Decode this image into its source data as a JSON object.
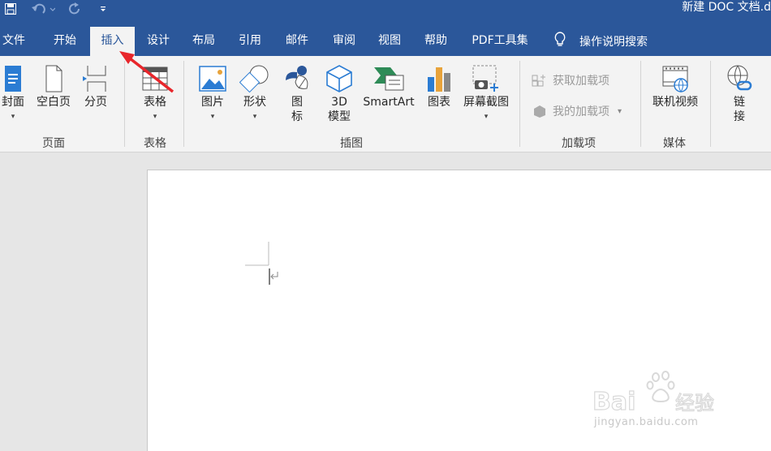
{
  "window": {
    "title": "新建 DOC 文档.d"
  },
  "qat": {
    "icons": [
      "save-icon",
      "undo-icon",
      "redo-icon",
      "customize-qat-icon"
    ]
  },
  "tabs": [
    {
      "label": "文件"
    },
    {
      "label": "开始"
    },
    {
      "label": "插入",
      "active": true
    },
    {
      "label": "设计"
    },
    {
      "label": "布局"
    },
    {
      "label": "引用"
    },
    {
      "label": "邮件"
    },
    {
      "label": "审阅"
    },
    {
      "label": "视图"
    },
    {
      "label": "帮助"
    },
    {
      "label": "PDF工具集"
    }
  ],
  "tell_me": {
    "label": "操作说明搜索",
    "icon": "lightbulb-icon"
  },
  "ribbon": {
    "pages_group": {
      "label": "页面",
      "cover": "封面",
      "blank": "空白页",
      "break": "分页"
    },
    "tables_group": {
      "label": "表格",
      "table": "表格"
    },
    "illustrations_group": {
      "label": "插图",
      "pictures": "图片",
      "shapes": "形状",
      "icons_line1": "图",
      "icons_line2": "标",
      "model_line1": "3D",
      "model_line2": "模型",
      "smartart": "SmartArt",
      "chart": "图表",
      "screenshot": "屏幕截图"
    },
    "addins_group": {
      "label": "加载项",
      "get": "获取加载项",
      "mine": "我的加载项"
    },
    "media_group": {
      "label": "媒体",
      "video": "联机视频"
    },
    "links_group": {
      "link_line1": "链",
      "link_line2": "接"
    }
  },
  "colors": {
    "brand": "#2b579a",
    "ribbon_bg": "#f3f3f3",
    "arrow": "#e8262b"
  },
  "watermark": {
    "brand": "Baidu经验",
    "url": "jingyan.baidu.com"
  }
}
